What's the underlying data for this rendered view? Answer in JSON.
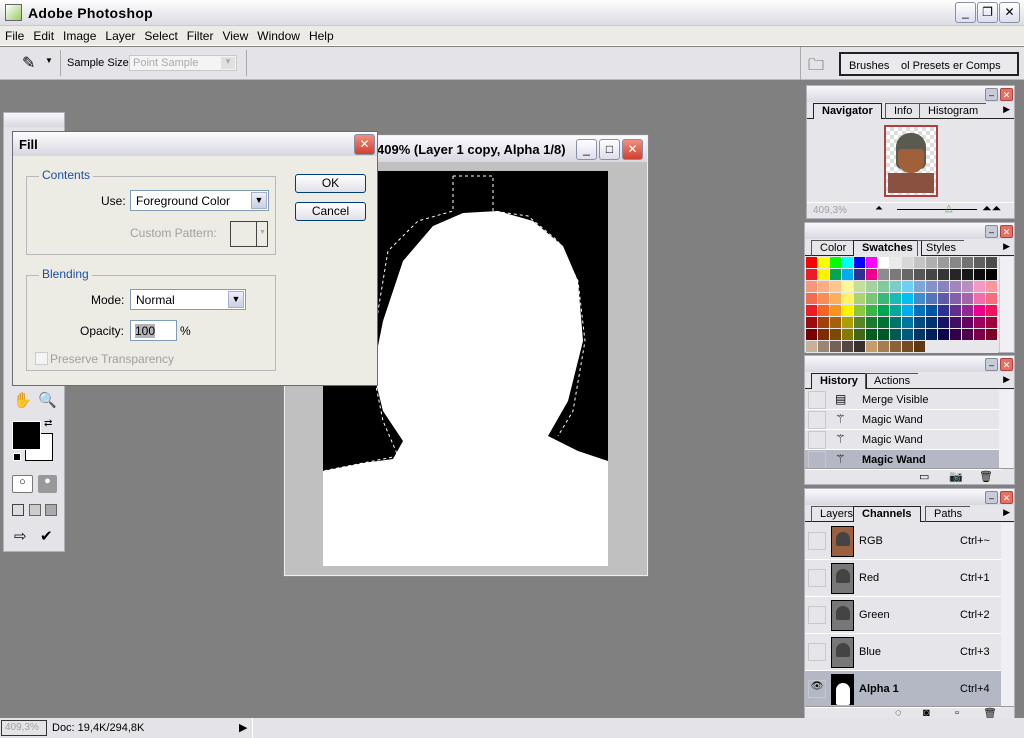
{
  "app": {
    "title": "Adobe Photoshop",
    "window_buttons": [
      "minimize",
      "restore",
      "close"
    ]
  },
  "menu": [
    "File",
    "Edit",
    "Image",
    "Layer",
    "Select",
    "Filter",
    "View",
    "Window",
    "Help"
  ],
  "options": {
    "tool_icon": "eyedropper-icon",
    "sample_size_label": "Sample Size:",
    "sample_size_value": "Point Sample",
    "palette_well_tabs": [
      "Brushes",
      "ol Presets",
      "er Comps"
    ]
  },
  "document": {
    "title": "409% (Layer 1 copy, Alpha 1/8)"
  },
  "fill_dialog": {
    "title": "Fill",
    "contents_legend": "Contents",
    "use_label": "Use:",
    "use_value": "Foreground Color",
    "custom_pattern_label": "Custom Pattern:",
    "blending_legend": "Blending",
    "mode_label": "Mode:",
    "mode_value": "Normal",
    "opacity_label": "Opacity:",
    "opacity_value": "100",
    "opacity_unit": "%",
    "preserve_label": "Preserve Transparency",
    "preserve_checked": false,
    "ok": "OK",
    "cancel": "Cancel"
  },
  "toolbox": {
    "foreground": "#000000",
    "background": "#ffffff"
  },
  "navigator": {
    "tabs": [
      "Navigator",
      "Info",
      "Histogram"
    ],
    "zoom": "409,3%"
  },
  "swatches": {
    "tabs": [
      "Color",
      "Swatches",
      "Styles"
    ],
    "rows": [
      [
        "#ff0000",
        "#ffff00",
        "#00ff00",
        "#00ffff",
        "#0000ff",
        "#ff00ff",
        "#ffffff",
        "#ebebeb",
        "#d7d7d7",
        "#c3c3c3",
        "#afafaf",
        "#9b9b9b",
        "#878787",
        "#737373",
        "#5f5f5f",
        "#4b4b4b"
      ],
      [
        "#ed1c24",
        "#fff200",
        "#00a651",
        "#00aeef",
        "#2e3192",
        "#ec008c",
        "#8c8c8c",
        "#7a7a7a",
        "#686868",
        "#575757",
        "#464646",
        "#363636",
        "#262626",
        "#181818",
        "#0c0c0c",
        "#000000"
      ],
      [
        "#f7977a",
        "#f9ad81",
        "#fdc68a",
        "#fff79a",
        "#c4df9b",
        "#a3d39c",
        "#82ca9d",
        "#7bcdc8",
        "#6ecff6",
        "#7ea7d8",
        "#8493ca",
        "#8882be",
        "#a187be",
        "#bc8dbf",
        "#f49ac2",
        "#f6989d"
      ],
      [
        "#f26c4f",
        "#f68e55",
        "#fbaf5c",
        "#fff467",
        "#acd372",
        "#7cc576",
        "#3bb878",
        "#1abbb4",
        "#00bff3",
        "#438ccb",
        "#5574b9",
        "#605ca8",
        "#855fa8",
        "#a763a8",
        "#f06ea9",
        "#f26d7d"
      ],
      [
        "#ed1c24",
        "#f26522",
        "#f7941d",
        "#fff200",
        "#8dc63f",
        "#39b54a",
        "#00a651",
        "#00a99d",
        "#00aeef",
        "#0072bc",
        "#0054a6",
        "#2e3192",
        "#662d91",
        "#92278f",
        "#ec008c",
        "#ed145b"
      ],
      [
        "#9e0b0f",
        "#a0410d",
        "#a36209",
        "#aba000",
        "#598527",
        "#1a7b30",
        "#007236",
        "#00746b",
        "#0076a3",
        "#004b80",
        "#003471",
        "#1b1464",
        "#440e62",
        "#630460",
        "#9e005d",
        "#9e0039"
      ],
      [
        "#790000",
        "#7b2e00",
        "#7d4900",
        "#827b00",
        "#406618",
        "#005e20",
        "#005826",
        "#005952",
        "#005b7f",
        "#003663",
        "#002157",
        "#0d004c",
        "#32004b",
        "#4b0049",
        "#7b0046",
        "#7a0026"
      ],
      [
        "#c7b299",
        "#998675",
        "#736357",
        "#534741",
        "#37302d",
        "#c69c6d",
        "#a67c52",
        "#8c6239",
        "#754c24",
        "#603913"
      ]
    ]
  },
  "history": {
    "tabs": [
      "History",
      "Actions"
    ],
    "items": [
      {
        "label": "Merge Visible",
        "icon": "merge-visible-icon",
        "selected": false
      },
      {
        "label": "Magic Wand",
        "icon": "magic-wand-icon",
        "selected": false
      },
      {
        "label": "Magic Wand",
        "icon": "magic-wand-icon",
        "selected": false
      },
      {
        "label": "Magic Wand",
        "icon": "magic-wand-icon",
        "selected": true
      }
    ]
  },
  "channels": {
    "tabs": [
      "Layers",
      "Channels",
      "Paths"
    ],
    "items": [
      {
        "name": "RGB",
        "shortcut": "Ctrl+~",
        "selected": false,
        "visible": false
      },
      {
        "name": "Red",
        "shortcut": "Ctrl+1",
        "selected": false,
        "visible": false
      },
      {
        "name": "Green",
        "shortcut": "Ctrl+2",
        "selected": false,
        "visible": false
      },
      {
        "name": "Blue",
        "shortcut": "Ctrl+3",
        "selected": false,
        "visible": false
      },
      {
        "name": "Alpha 1",
        "shortcut": "Ctrl+4",
        "selected": true,
        "visible": true
      }
    ]
  },
  "status": {
    "zoom": "409,3%",
    "doc": "Doc: 19,4K/294,8K"
  }
}
